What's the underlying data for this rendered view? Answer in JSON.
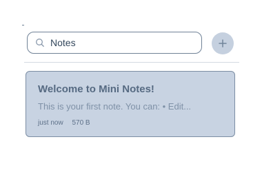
{
  "search": {
    "value": "Notes",
    "icon": "search-icon"
  },
  "toolbar": {
    "add_icon": "plus-icon"
  },
  "notes": [
    {
      "title": "Welcome to Mini Notes!",
      "preview": "This is your first note. You can: • Edit...",
      "time": "just now",
      "size": "570 B"
    }
  ],
  "colors": {
    "card_background": "#c8d3e2",
    "card_border": "#7b8da3",
    "add_button_background": "#c5d0df",
    "title_text": "#566a82",
    "muted_text": "#7f91a7"
  }
}
